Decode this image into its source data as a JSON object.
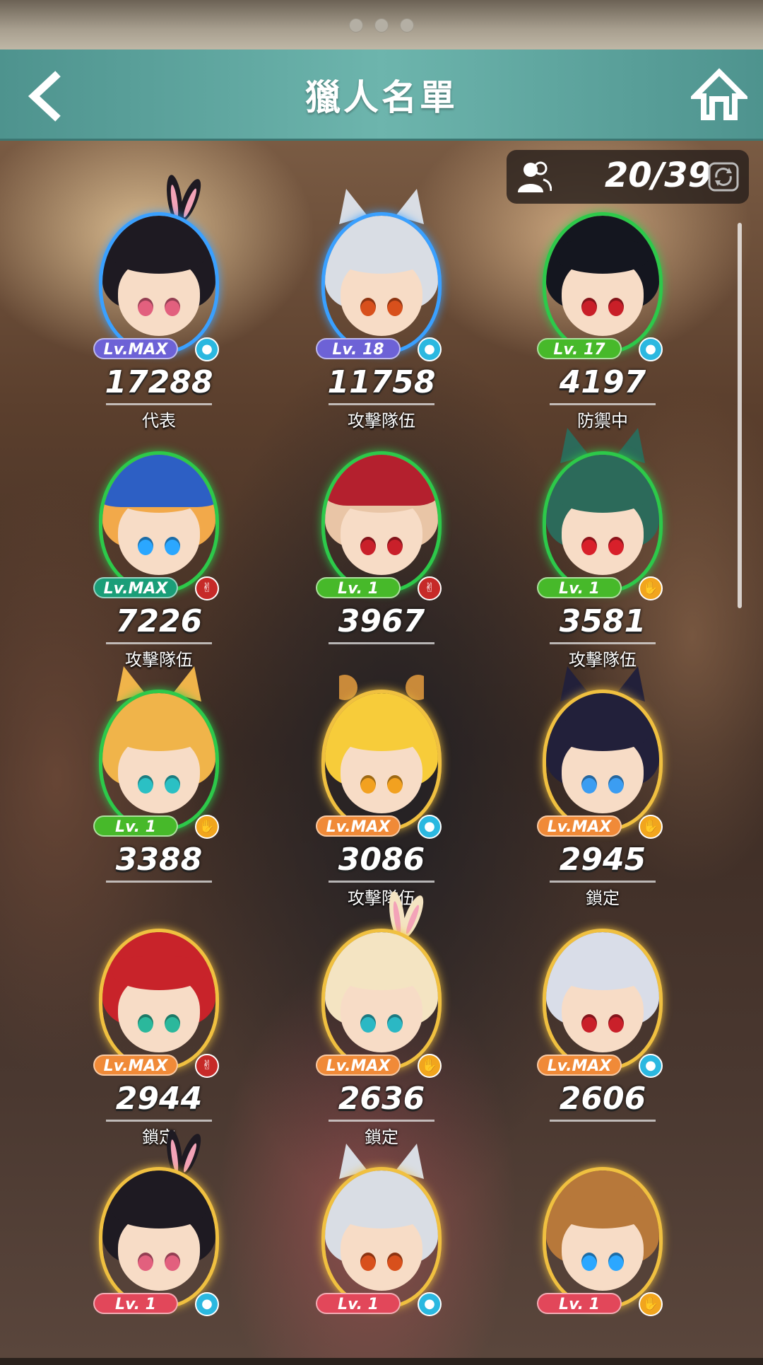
{
  "header": {
    "title": "獵人名單"
  },
  "counter": {
    "text": "20/39",
    "icon": "users-icon",
    "refresh_icon": "refresh-icon"
  },
  "heroes": [
    {
      "level": "Lv.MAX",
      "power": "17288",
      "status": "代表",
      "element": "water",
      "element_color": "#2bb8e0",
      "badge_color": "#6d62d6",
      "ring": "#3aa0ff",
      "hair": "#1e1a22",
      "eye": "#e2607e",
      "ears": "bunny"
    },
    {
      "level": "Lv. 18",
      "power": "11758",
      "status": "攻擊隊伍",
      "element": "water",
      "element_color": "#2bb8e0",
      "badge_color": "#6d62d6",
      "ring": "#3aa0ff",
      "hair": "#d9dde4",
      "eye": "#d8501c",
      "ears": "cat"
    },
    {
      "level": "Lv. 17",
      "power": "4197",
      "status": "防禦中",
      "element": "water",
      "element_color": "#2bb8e0",
      "badge_color": "#47b92a",
      "ring": "#2dc94a",
      "hair": "#14161f",
      "eye": "#c91f28",
      "ears": ""
    },
    {
      "level": "Lv.MAX",
      "power": "7226",
      "status": "攻擊隊伍",
      "element": "scissors",
      "element_color": "#c62a28",
      "badge_color": "#1a9e78",
      "ring": "#2dc94a",
      "hair": "#f2a94a",
      "eye": "#2ba7ff",
      "ears": "cap"
    },
    {
      "level": "Lv. 1",
      "power": "3967",
      "status": "",
      "element": "scissors",
      "element_color": "#c62a28",
      "badge_color": "#47b92a",
      "ring": "#2dc94a",
      "hair": "#e9c5a6",
      "eye": "#c9202a",
      "ears": "redcap"
    },
    {
      "level": "Lv. 1",
      "power": "3581",
      "status": "攻擊隊伍",
      "element": "paper",
      "element_color": "#f1a51e",
      "badge_color": "#47b92a",
      "ring": "#2dc94a",
      "hair": "#2c6a5a",
      "eye": "#d8202a",
      "ears": "wolf"
    },
    {
      "level": "Lv. 1",
      "power": "3388",
      "status": "",
      "element": "paper",
      "element_color": "#f1a51e",
      "badge_color": "#47b92a",
      "ring": "#2dc94a",
      "hair": "#f0b44a",
      "eye": "#2bc0c4",
      "ears": "fox"
    },
    {
      "level": "Lv.MAX",
      "power": "3086",
      "status": "攻擊隊伍",
      "element": "water",
      "element_color": "#2bb8e0",
      "badge_color": "#f08a38",
      "ring": "#f0c040",
      "hair": "#f7cc3a",
      "eye": "#f2a120",
      "ears": "bear"
    },
    {
      "level": "Lv.MAX",
      "power": "2945",
      "status": "鎖定",
      "element": "paper",
      "element_color": "#f1a51e",
      "badge_color": "#f08a38",
      "ring": "#f0c040",
      "hair": "#22203a",
      "eye": "#3b9df2",
      "ears": "wolf"
    },
    {
      "level": "Lv.MAX",
      "power": "2944",
      "status": "鎖定",
      "element": "scissors",
      "element_color": "#c62a28",
      "badge_color": "#f08a38",
      "ring": "#f0c040",
      "hair": "#c8232a",
      "eye": "#2bb89c",
      "ears": ""
    },
    {
      "level": "Lv.MAX",
      "power": "2636",
      "status": "鎖定",
      "element": "paper",
      "element_color": "#f1a51e",
      "badge_color": "#f08a38",
      "ring": "#f0c040",
      "hair": "#f4e4c2",
      "eye": "#2bb8c4",
      "ears": "bunny"
    },
    {
      "level": "Lv.MAX",
      "power": "2606",
      "status": "",
      "element": "water",
      "element_color": "#2bb8e0",
      "badge_color": "#f08a38",
      "ring": "#f0c040",
      "hair": "#d9dde8",
      "eye": "#c9202a",
      "ears": ""
    },
    {
      "level": "Lv. 1",
      "power": "",
      "status": "",
      "element": "water",
      "element_color": "#2bb8e0",
      "badge_color": "#e2475a",
      "ring": "#f0c040",
      "hair": "#1e1a22",
      "eye": "#e2607e",
      "ears": "bunny"
    },
    {
      "level": "Lv. 1",
      "power": "",
      "status": "",
      "element": "water",
      "element_color": "#2bb8e0",
      "badge_color": "#e2475a",
      "ring": "#f0c040",
      "hair": "#d9dde4",
      "eye": "#d8501c",
      "ears": "cat"
    },
    {
      "level": "Lv. 1",
      "power": "",
      "status": "",
      "element": "paper",
      "element_color": "#f1a51e",
      "badge_color": "#e2475a",
      "ring": "#f0c040",
      "hair": "#b7783a",
      "eye": "#2ba7ff",
      "ears": ""
    }
  ]
}
